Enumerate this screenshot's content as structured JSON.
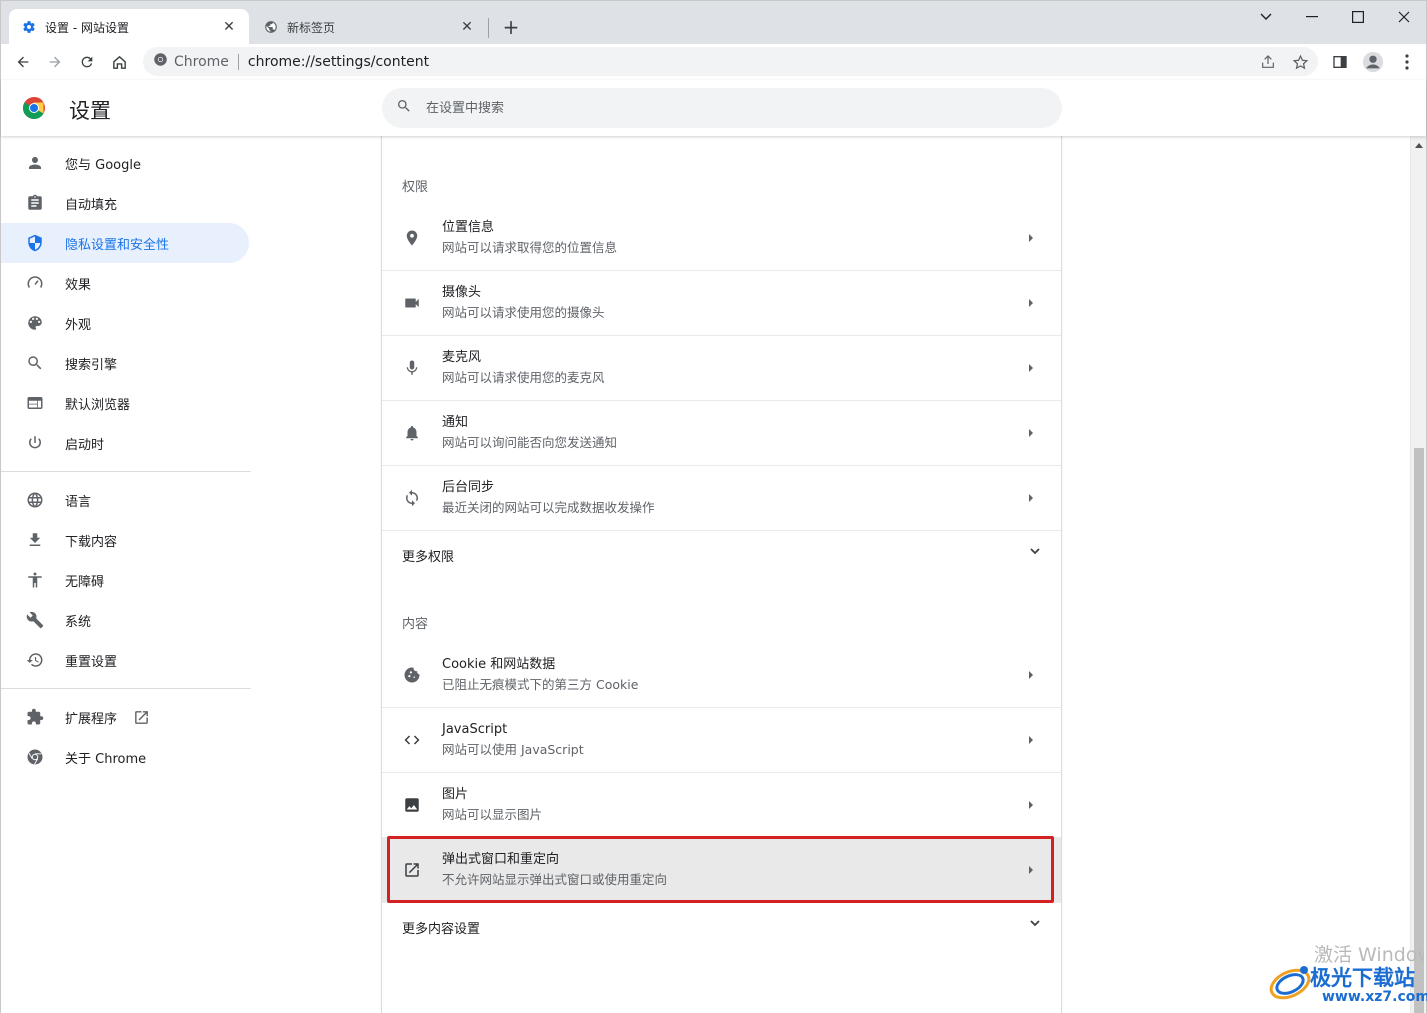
{
  "tabs": [
    {
      "title": "设置 - 网站设置",
      "active": true
    },
    {
      "title": "新标签页",
      "active": false
    }
  ],
  "omnibox": {
    "site_label": "Chrome",
    "url": "chrome://settings/content"
  },
  "header": {
    "title": "设置",
    "search_placeholder": "在设置中搜索"
  },
  "sidebar": {
    "group1": [
      {
        "label": "您与 Google",
        "icon": "person-icon"
      },
      {
        "label": "自动填充",
        "icon": "clipboard-icon"
      },
      {
        "label": "隐私设置和安全性",
        "icon": "shield-icon",
        "selected": true
      },
      {
        "label": "效果",
        "icon": "speedometer-icon"
      },
      {
        "label": "外观",
        "icon": "palette-icon"
      },
      {
        "label": "搜索引擎",
        "icon": "search-icon"
      },
      {
        "label": "默认浏览器",
        "icon": "browser-window-icon"
      },
      {
        "label": "启动时",
        "icon": "power-icon"
      }
    ],
    "group2": [
      {
        "label": "语言",
        "icon": "globe-icon"
      },
      {
        "label": "下载内容",
        "icon": "download-icon"
      },
      {
        "label": "无障碍",
        "icon": "accessibility-icon"
      },
      {
        "label": "系统",
        "icon": "wrench-icon"
      },
      {
        "label": "重置设置",
        "icon": "restore-icon"
      }
    ],
    "group3": [
      {
        "label": "扩展程序",
        "icon": "puzzle-icon"
      },
      {
        "label": "关于 Chrome",
        "icon": "chrome-icon"
      }
    ]
  },
  "permissions": {
    "title": "权限",
    "rows": [
      {
        "label": "位置信息",
        "sub": "网站可以请求取得您的位置信息",
        "icon": "location-pin-icon"
      },
      {
        "label": "摄像头",
        "sub": "网站可以请求使用您的摄像头",
        "icon": "camera-icon"
      },
      {
        "label": "麦克风",
        "sub": "网站可以请求使用您的麦克风",
        "icon": "microphone-icon"
      },
      {
        "label": "通知",
        "sub": "网站可以询问能否向您发送通知",
        "icon": "bell-icon"
      },
      {
        "label": "后台同步",
        "sub": "最近关闭的网站可以完成数据收发操作",
        "icon": "sync-icon"
      }
    ],
    "more_label": "更多权限"
  },
  "content": {
    "title": "内容",
    "rows": [
      {
        "label": "Cookie 和网站数据",
        "sub": "已阻止无痕模式下的第三方 Cookie",
        "icon": "cookie-icon"
      },
      {
        "label": "JavaScript",
        "sub": "网站可以使用 JavaScript",
        "icon": "code-icon"
      },
      {
        "label": "图片",
        "sub": "网站可以显示图片",
        "icon": "image-icon"
      },
      {
        "label": "弹出式窗口和重定向",
        "sub": "不允许网站显示弹出式窗口或使用重定向",
        "icon": "popup-icon"
      }
    ],
    "more_label": "更多内容设置"
  },
  "watermark": {
    "activate": "激活 Windows",
    "site_title": "极光下载站",
    "site_url": "www.xz7.com"
  },
  "colors": {
    "accent": "#1a73e8",
    "selected_bg": "#e8f0fe",
    "highlight_border": "#d42020"
  }
}
